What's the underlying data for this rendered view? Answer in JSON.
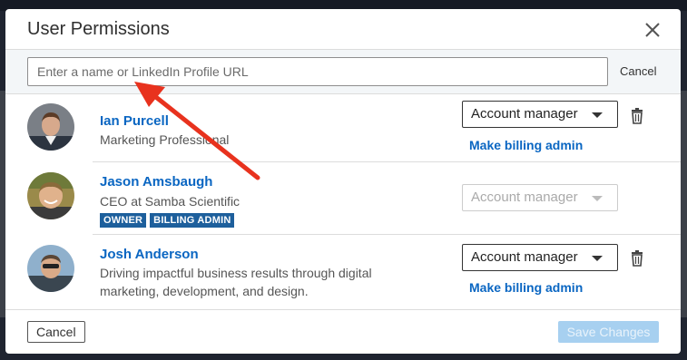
{
  "dialog": {
    "title": "User Permissions",
    "close_icon": "close-icon"
  },
  "search": {
    "placeholder": "Enter a name or LinkedIn Profile URL",
    "value": "",
    "cancel_label": "Cancel"
  },
  "users": [
    {
      "name": "Ian Purcell",
      "title": "Marketing Professional",
      "role": "Account manager",
      "role_enabled": true,
      "billing_link": "Make billing admin",
      "badges": []
    },
    {
      "name": "Jason Amsbaugh",
      "title": "CEO at Samba Scientific",
      "role": "Account manager",
      "role_enabled": false,
      "billing_link": "",
      "badges": [
        "OWNER",
        "BILLING ADMIN"
      ]
    },
    {
      "name": "Josh Anderson",
      "title": "Driving impactful business results through digital marketing, development, and design.",
      "role": "Account manager",
      "role_enabled": true,
      "billing_link": "Make billing admin",
      "badges": []
    }
  ],
  "footer": {
    "cancel_label": "Cancel",
    "save_label": "Save Changes",
    "save_enabled": false
  },
  "colors": {
    "link": "#0a66c2",
    "badge": "#1d5f9c",
    "annotation_arrow": "#e8321e"
  }
}
